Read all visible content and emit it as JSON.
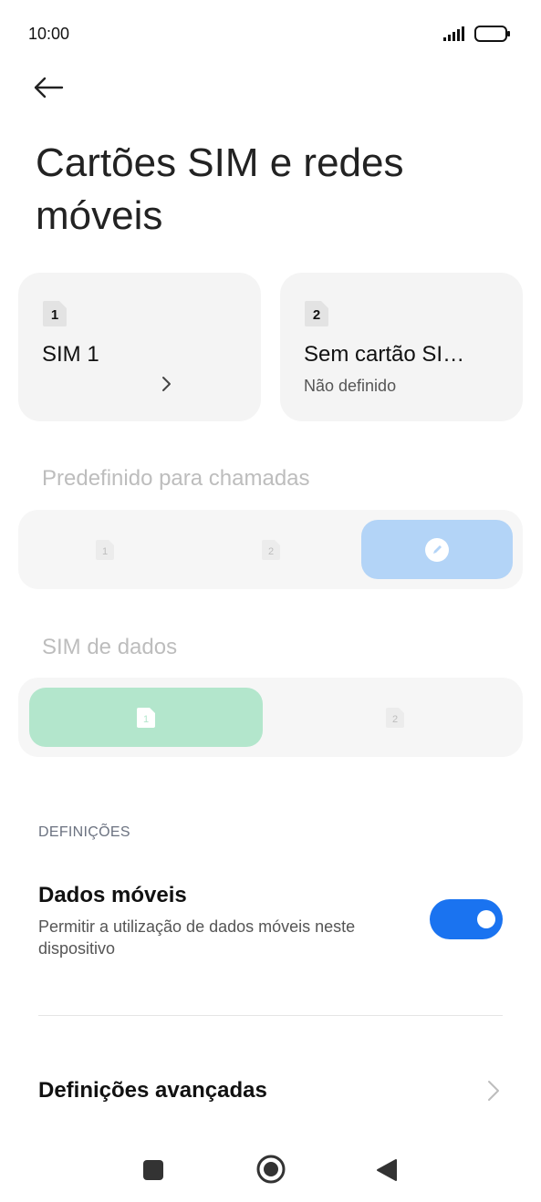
{
  "status_bar": {
    "time": "10:00"
  },
  "header": {
    "title": "Cartões SIM e redes móveis",
    "back_icon": "arrow-left-icon"
  },
  "sim_cards": [
    {
      "slot": "1",
      "name": "SIM 1",
      "status": ""
    },
    {
      "slot": "2",
      "name": "Sem cartão SI…",
      "status": "Não definido"
    }
  ],
  "calls_default": {
    "label": "Predefinido para chamadas",
    "options": [
      "1",
      "2"
    ],
    "selected_index": 2,
    "selected_icon": "pencil-icon",
    "accent": "#b3d4f7"
  },
  "data_sim": {
    "label": "SIM de dados",
    "options": [
      "1",
      "2"
    ],
    "selected_index": 0,
    "accent": "#b3e6cc"
  },
  "settings": {
    "section_label": "DEFINIÇÕES",
    "mobile_data": {
      "title": "Dados móveis",
      "subtitle": "Permitir a utilização de dados móveis neste dispositivo",
      "enabled": true,
      "accent": "#1a73f0"
    },
    "advanced": {
      "title": "Definições avançadas"
    }
  },
  "nav_bar": {
    "items": [
      "square-icon",
      "home-circle-icon",
      "back-triangle-icon"
    ]
  }
}
